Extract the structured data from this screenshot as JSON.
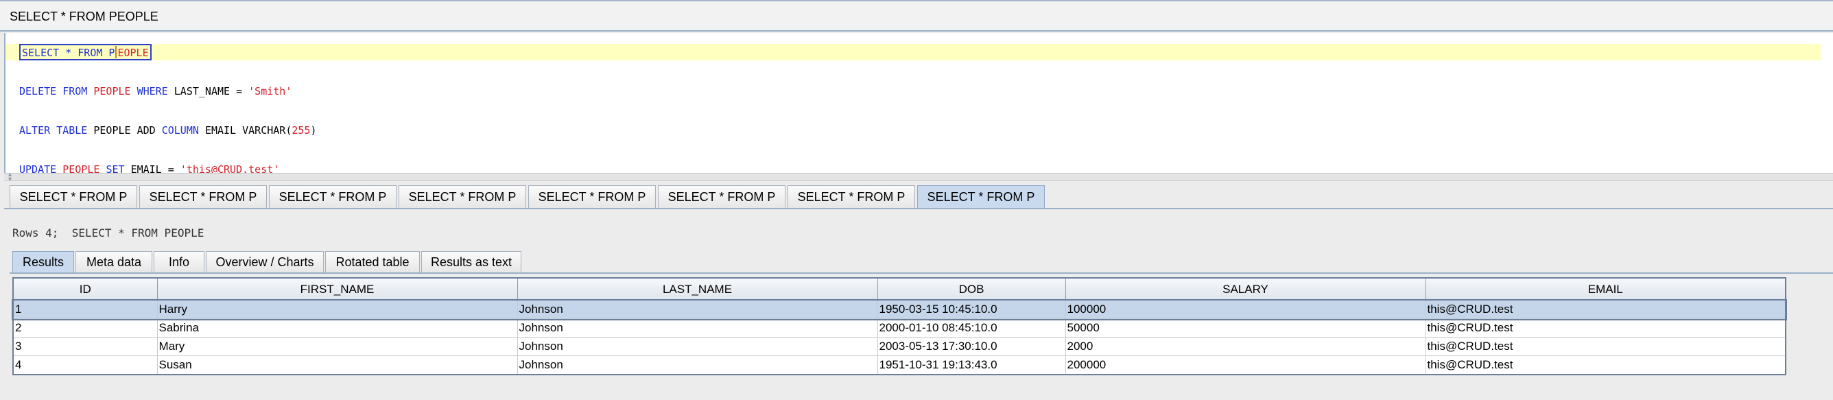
{
  "window": {
    "title": "SELECT * FROM PEOPLE"
  },
  "editor": {
    "lines": [
      {
        "p1": "SELECT * FROM P",
        "p2": "EOPLE"
      },
      {
        "kw": "DELETE FROM",
        "tbl": "PEOPLE",
        "kw2": "WHERE",
        "plain": "LAST_NAME =",
        "str": "'Smith'"
      },
      {
        "kw": "ALTER TABLE",
        "plain": "PEOPLE ADD",
        "kw2": "COLUMN",
        "plain2": "EMAIL VARCHAR(",
        "num": "255",
        "plain3": ")"
      },
      {
        "kw": "UPDATE",
        "tbl": "PEOPLE",
        "kw2": "SET",
        "plain": "EMAIL =",
        "str": "'this@CRUD.test'"
      }
    ]
  },
  "query_tabs": [
    "SELECT * FROM P",
    "SELECT * FROM P",
    "SELECT * FROM P",
    "SELECT * FROM P",
    "SELECT * FROM P",
    "SELECT * FROM P",
    "SELECT * FROM P",
    "SELECT * FROM P"
  ],
  "rows_info": "Rows 4;  SELECT * FROM PEOPLE",
  "result_tabs": [
    "Results",
    "Meta data",
    "Info",
    "Overview / Charts",
    "Rotated table",
    "Results as text"
  ],
  "table": {
    "columns": [
      "ID",
      "FIRST_NAME",
      "LAST_NAME",
      "DOB",
      "SALARY",
      "EMAIL"
    ],
    "rows": [
      [
        "1",
        "Harry",
        "Johnson",
        "1950-03-15 10:45:10.0",
        "100000",
        "this@CRUD.test"
      ],
      [
        "2",
        "Sabrina",
        "Johnson",
        "2000-01-10 08:45:10.0",
        "50000",
        "this@CRUD.test"
      ],
      [
        "3",
        "Mary",
        "Johnson",
        "2003-05-13 17:30:10.0",
        "2000",
        "this@CRUD.test"
      ],
      [
        "4",
        "Susan",
        "Johnson",
        "1951-10-31 19:13:43.0",
        "200000",
        "this@CRUD.test"
      ]
    ]
  }
}
